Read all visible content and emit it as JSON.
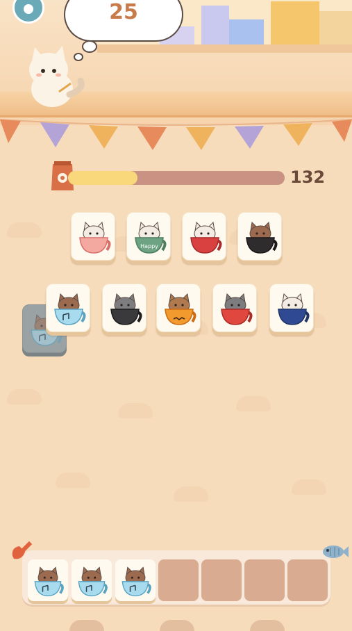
{
  "hud": {
    "level_number": "25",
    "score": "132",
    "progress": 0.32,
    "settings_icon": "gear-icon",
    "food_bag_icon": "cat-food-bag-icon"
  },
  "board": {
    "row1": [
      {
        "design": "pink-floral-cup",
        "cat": "calico"
      },
      {
        "design": "green-happy-cup",
        "cat": "calico",
        "cup_text": "Happy"
      },
      {
        "design": "red-cup",
        "cat": "calico"
      },
      {
        "design": "black-cup",
        "cat": "brown-tabby"
      }
    ],
    "row2": [
      {
        "design": "blue-music-cup",
        "cat": "brown-tabby"
      },
      {
        "design": "black-stripe-cup",
        "cat": "gray-tabby"
      },
      {
        "design": "pumpkin-cup",
        "cat": "brown-witch"
      },
      {
        "design": "christmas-cup",
        "cat": "gray-tabby"
      },
      {
        "design": "navy-cup",
        "cat": "calico"
      }
    ],
    "hidden_tile": {
      "design": "blue-music-cup",
      "cat": "brown-tabby"
    }
  },
  "tray": {
    "slots": [
      {
        "design": "blue-music-cup",
        "cat": "brown-tabby"
      },
      {
        "design": "blue-music-cup",
        "cat": "brown-tabby"
      },
      {
        "design": "blue-music-cup",
        "cat": "brown-tabby"
      },
      null,
      null,
      null,
      null
    ],
    "scoop_icon": "scoop-icon",
    "fish_icon": "fish-icon"
  },
  "colors": {
    "background": "#f7dcbc",
    "progress_fill": "#f9d77b",
    "progress_track": "#c99283",
    "score_text": "#6b4a3a",
    "level_text": "#c87b4a"
  }
}
